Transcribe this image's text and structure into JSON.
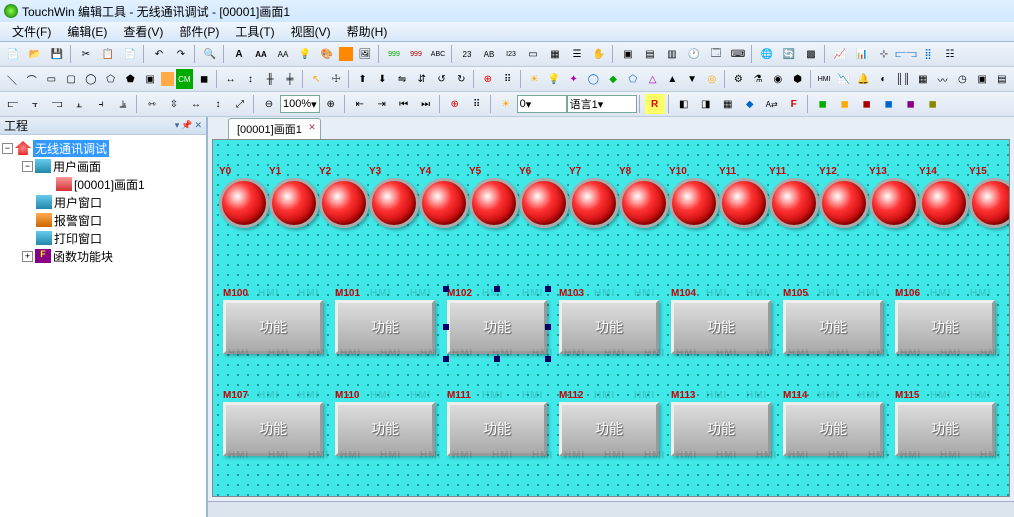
{
  "title": "TouchWin 编辑工具 - 无线通讯调试 - [00001]画面1",
  "menus": [
    "文件(F)",
    "编辑(E)",
    "查看(V)",
    "部件(P)",
    "工具(T)",
    "视图(V)",
    "帮助(H)"
  ],
  "toolbar3_zoom": "100%",
  "toolbar3_num": "0",
  "toolbar3_lang": "语言1",
  "sidebar_title": "工程",
  "tree": {
    "root": "无线通讯调试",
    "n1": "用户画面",
    "n1_1": "[00001]画面1",
    "n2": "用户窗口",
    "n3": "报警窗口",
    "n4": "打印窗口",
    "n5": "函数功能块"
  },
  "tab_label": "[00001]画面1",
  "lamps": [
    "Y0",
    "Y1",
    "Y2",
    "Y3",
    "Y4",
    "Y5",
    "Y6",
    "Y7",
    "Y8",
    "Y10",
    "Y11",
    "Y11",
    "Y12",
    "Y13",
    "Y14",
    "Y15"
  ],
  "btn_label": "功能",
  "row1_ids": [
    "M100",
    "M101",
    "M102",
    "M103",
    "M104",
    "M105",
    "M106"
  ],
  "row2_ids": [
    "M107",
    "M110",
    "M111",
    "M112",
    "M113",
    "M114",
    "M115"
  ]
}
